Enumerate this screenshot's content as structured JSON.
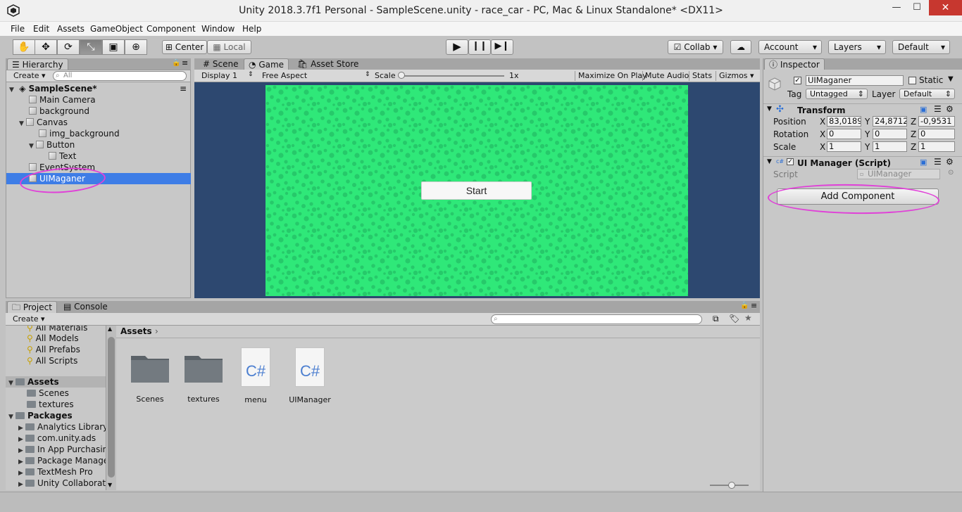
{
  "window": {
    "title": "Unity 2018.3.7f1 Personal - SampleScene.unity - race_car - PC, Mac & Linux Standalone* <DX11>",
    "minimize": "—",
    "maximize": "☐",
    "close": "✕"
  },
  "menu": [
    "File",
    "Edit",
    "Assets",
    "GameObject",
    "Component",
    "Window",
    "Help"
  ],
  "toolbar": {
    "pivot": "Center",
    "space": "Local",
    "collab": "Collab ▾",
    "account": "Account",
    "layers": "Layers",
    "layout": "Default"
  },
  "hierarchy": {
    "tab": "Hierarchy",
    "create": "Create",
    "search_placeholder": "All",
    "scene": "SampleScene*",
    "items": [
      {
        "label": "Main Camera"
      },
      {
        "label": "background"
      },
      {
        "label": "Canvas"
      },
      {
        "label": "img_background"
      },
      {
        "label": "Button"
      },
      {
        "label": "Text"
      },
      {
        "label": "EventSystem"
      },
      {
        "label": "UIMaganer"
      }
    ]
  },
  "center": {
    "tabs": [
      "Scene",
      "Game",
      "Asset Store"
    ],
    "display": "Display 1",
    "aspect": "Free Aspect",
    "scale_label": "Scale",
    "scale_value": "1x",
    "maximize": "Maximize On Play",
    "mute": "Mute Audio",
    "stats": "Stats",
    "gizmos": "Gizmos",
    "start_button": "Start"
  },
  "inspector": {
    "tab": "Inspector",
    "object_name": "UIMaganer",
    "static_label": "Static",
    "tag_label": "Tag",
    "tag_value": "Untagged",
    "layer_label": "Layer",
    "layer_value": "Default",
    "transform": {
      "title": "Transform",
      "position_label": "Position",
      "rotation_label": "Rotation",
      "scale_label": "Scale",
      "position": {
        "x": "83,0189",
        "y": "24,8712",
        "z": "-0,9531"
      },
      "rotation": {
        "x": "0",
        "y": "0",
        "z": "0"
      },
      "scale": {
        "x": "1",
        "y": "1",
        "z": "1"
      }
    },
    "script_component": {
      "title": "UI Manager (Script)",
      "script_label": "Script",
      "script_value": "UIManager"
    },
    "add_component": "Add Component"
  },
  "project": {
    "tabs": [
      "Project",
      "Console"
    ],
    "create": "Create",
    "breadcrumb": "Assets",
    "favorites": [
      "All Materials",
      "All Models",
      "All Prefabs",
      "All Scripts"
    ],
    "assets_header": "Assets",
    "assets_children": [
      "Scenes",
      "textures"
    ],
    "packages_header": "Packages",
    "packages": [
      "Analytics Library",
      "com.unity.ads",
      "In App Purchasing",
      "Package Manager UI",
      "TextMesh Pro",
      "Unity Collaborate"
    ],
    "grid": [
      {
        "name": "Scenes",
        "kind": "folder"
      },
      {
        "name": "textures",
        "kind": "folder"
      },
      {
        "name": "menu",
        "kind": "script"
      },
      {
        "name": "UIManager",
        "kind": "script"
      }
    ],
    "cs_glyph": "C#"
  },
  "colors": {
    "selection": "#3e7de6",
    "game_green": "#2fe879",
    "game_bg": "#2d4870",
    "highlight": "#e040d8"
  }
}
